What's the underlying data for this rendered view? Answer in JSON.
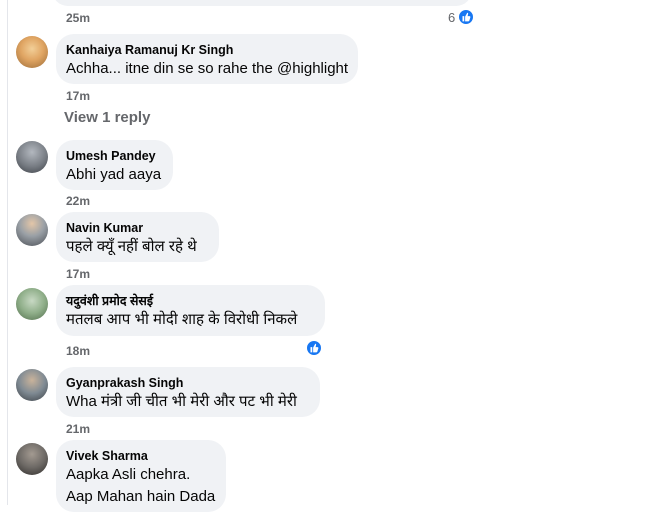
{
  "top_comment": {
    "time": "25m",
    "reaction_count": "6"
  },
  "comments": [
    {
      "author": "Kanhaiya Ramanuj Kr Singh",
      "lines": [
        "Achha... itne din se so rahe the @highlight"
      ],
      "time": "17m",
      "avatar_colors": [
        "#e9c28a",
        "#8a5a2b"
      ]
    },
    {
      "author": "Umesh Pandey",
      "lines": [
        "Abhi yad aaya"
      ],
      "time": "22m",
      "avatar_colors": [
        "#8a8f96",
        "#3b3f45"
      ]
    },
    {
      "author": "Navin Kumar",
      "lines": [
        "पहले क्यूँ नहीं बोल रहे थे"
      ],
      "time": "17m",
      "avatar_colors": [
        "#c9ccd1",
        "#5b5f66"
      ]
    },
    {
      "author": "यदुवंशी प्रमोद सेसई",
      "lines": [
        "मतलब आप भी मोदी शाह के विरोधी निकले"
      ],
      "time": "18m",
      "avatar_colors": [
        "#9fbf9a",
        "#4f6b4a"
      ]
    },
    {
      "author": "Gyanprakash Singh",
      "lines": [
        "Wha मंत्री जी चीत भी मेरी और पट भी मेरी"
      ],
      "time": "21m",
      "avatar_colors": [
        "#7f8a93",
        "#3a3f44"
      ]
    },
    {
      "author": "Vivek Sharma",
      "lines": [
        "Aapka Asli chehra.",
        "Aap Mahan hain Dada"
      ],
      "time": "",
      "avatar_colors": [
        "#6e6a66",
        "#2e2b29"
      ]
    }
  ],
  "view_replies_label": "View 1 reply",
  "accent_color": "#1877f2"
}
